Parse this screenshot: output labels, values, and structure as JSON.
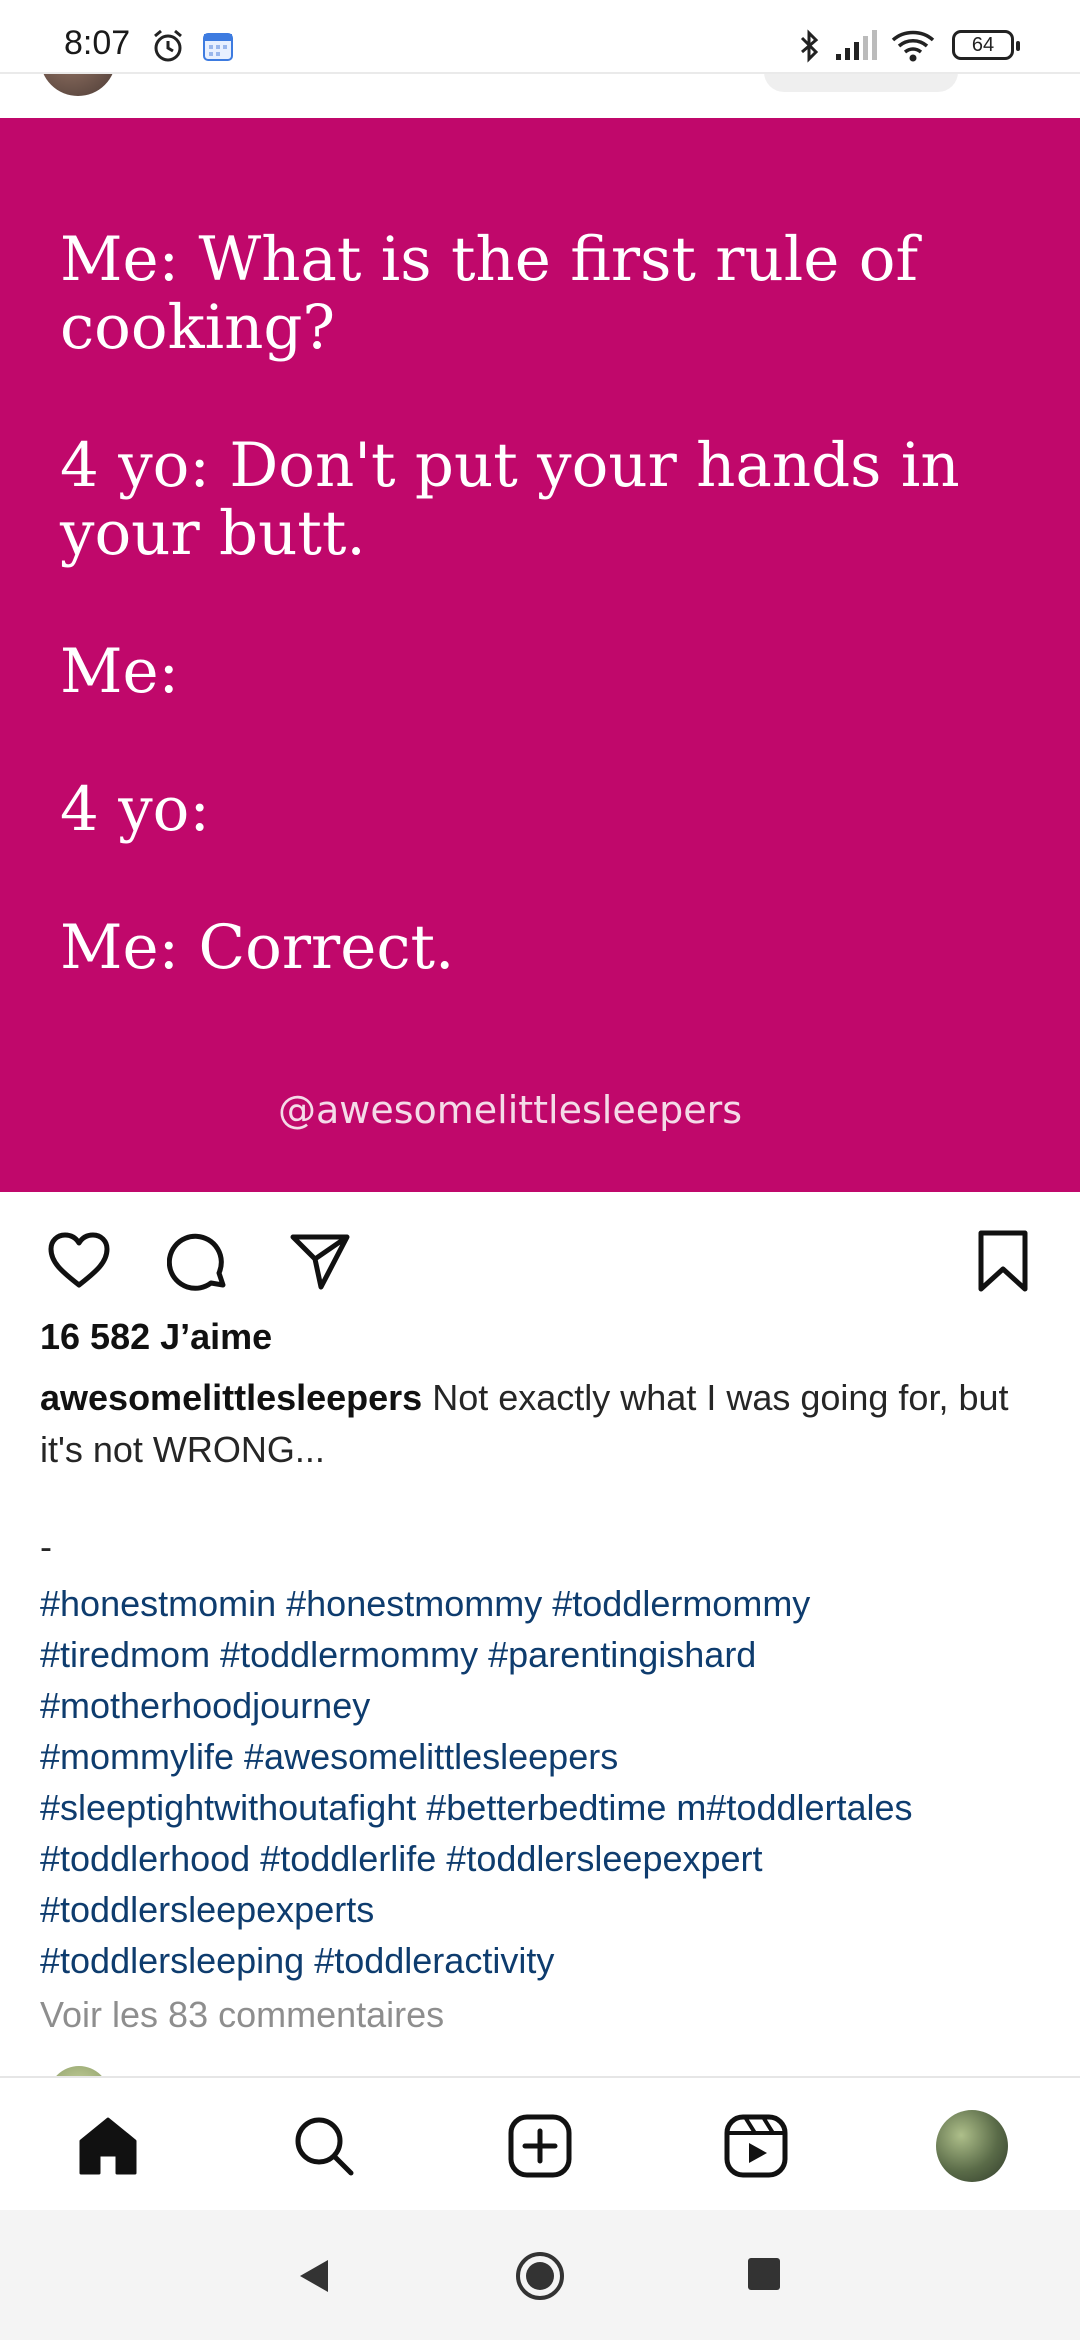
{
  "status_bar": {
    "time": "8:07",
    "battery": "64",
    "icons": [
      "alarm-icon",
      "calendar-icon",
      "bluetooth-icon",
      "signal-icon",
      "wifi-icon",
      "battery-icon"
    ]
  },
  "post": {
    "image_lines": [
      "Me: What is the first rule of cooking?",
      "4 yo: Don't put your hands in your butt.",
      "Me:",
      "4 yo:",
      "Me: Correct."
    ],
    "image_watermark": "@awesomelittlesleepers",
    "image_color": "#c0086b",
    "likes": "16 582 J’aime",
    "username": "awesomelittlesleepers",
    "caption": " Not exactly what I was going for, but it's not WRONG...",
    "separator": "-",
    "hashtag_lines": [
      "#honestmomin #honestmommy #toddlermommy",
      "#tiredmom #toddlermommy #parentingishard",
      "#motherhoodjourney",
      "#mommylife #awesomelittlesleepers",
      "#sleeptightwithoutafight #betterbedtime m#toddlertales",
      "#toddlerhood #toddlerlife #toddlersleepexpert",
      "#toddlersleepexperts",
      "#toddlersleeping #toddleractivity"
    ],
    "hashtag_color": "#0e3c6e",
    "view_comments": "Voir les 83 commentaires"
  },
  "actions": [
    "heart-icon",
    "comment-icon",
    "share-icon",
    "bookmark-icon"
  ],
  "bottom_nav": [
    "home-icon",
    "search-icon",
    "create-icon",
    "reels-icon",
    "profile-avatar"
  ]
}
